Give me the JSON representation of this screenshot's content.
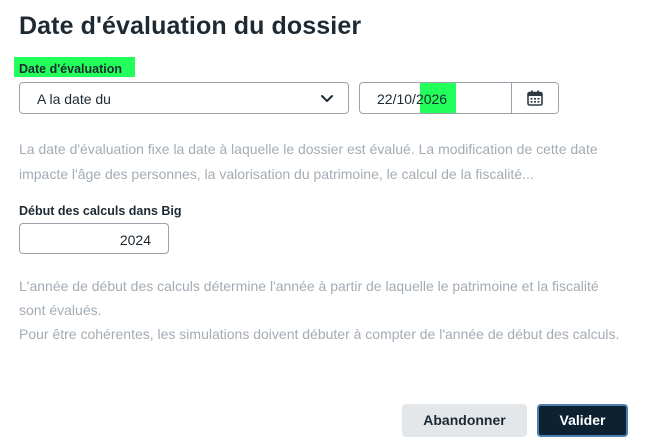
{
  "dialog": {
    "title": "Date d'évaluation du dossier"
  },
  "evaluation": {
    "label": "Date d'évaluation",
    "mode_selected": "A la date du",
    "date_prefix": "22/10/",
    "date_year": "2026",
    "help": "La date d'évaluation fixe la date à laquelle le dossier est évalué. La modification de cette date impacte l'âge des personnes, la valorisation du patrimoine, le calcul de la fiscalité..."
  },
  "start": {
    "label": "Début des calculs dans Big",
    "year": "2024",
    "help_line1": "L'année de début des calculs détermine l'année à partir de laquelle le patrimoine et la fiscalité sont évalués.",
    "help_line2": "Pour être cohérentes, les simulations doivent débuter à compter de l'année de début des calculs."
  },
  "buttons": {
    "cancel": "Abandonner",
    "confirm": "Valider"
  },
  "icons": {
    "dropdown": "chevron-down-icon",
    "calendar": "calendar-icon"
  },
  "colors": {
    "highlight": "#22ff5a",
    "primary_button": "#0c2233",
    "secondary_button": "#e3e7ea",
    "help_text": "#a3acb4"
  }
}
